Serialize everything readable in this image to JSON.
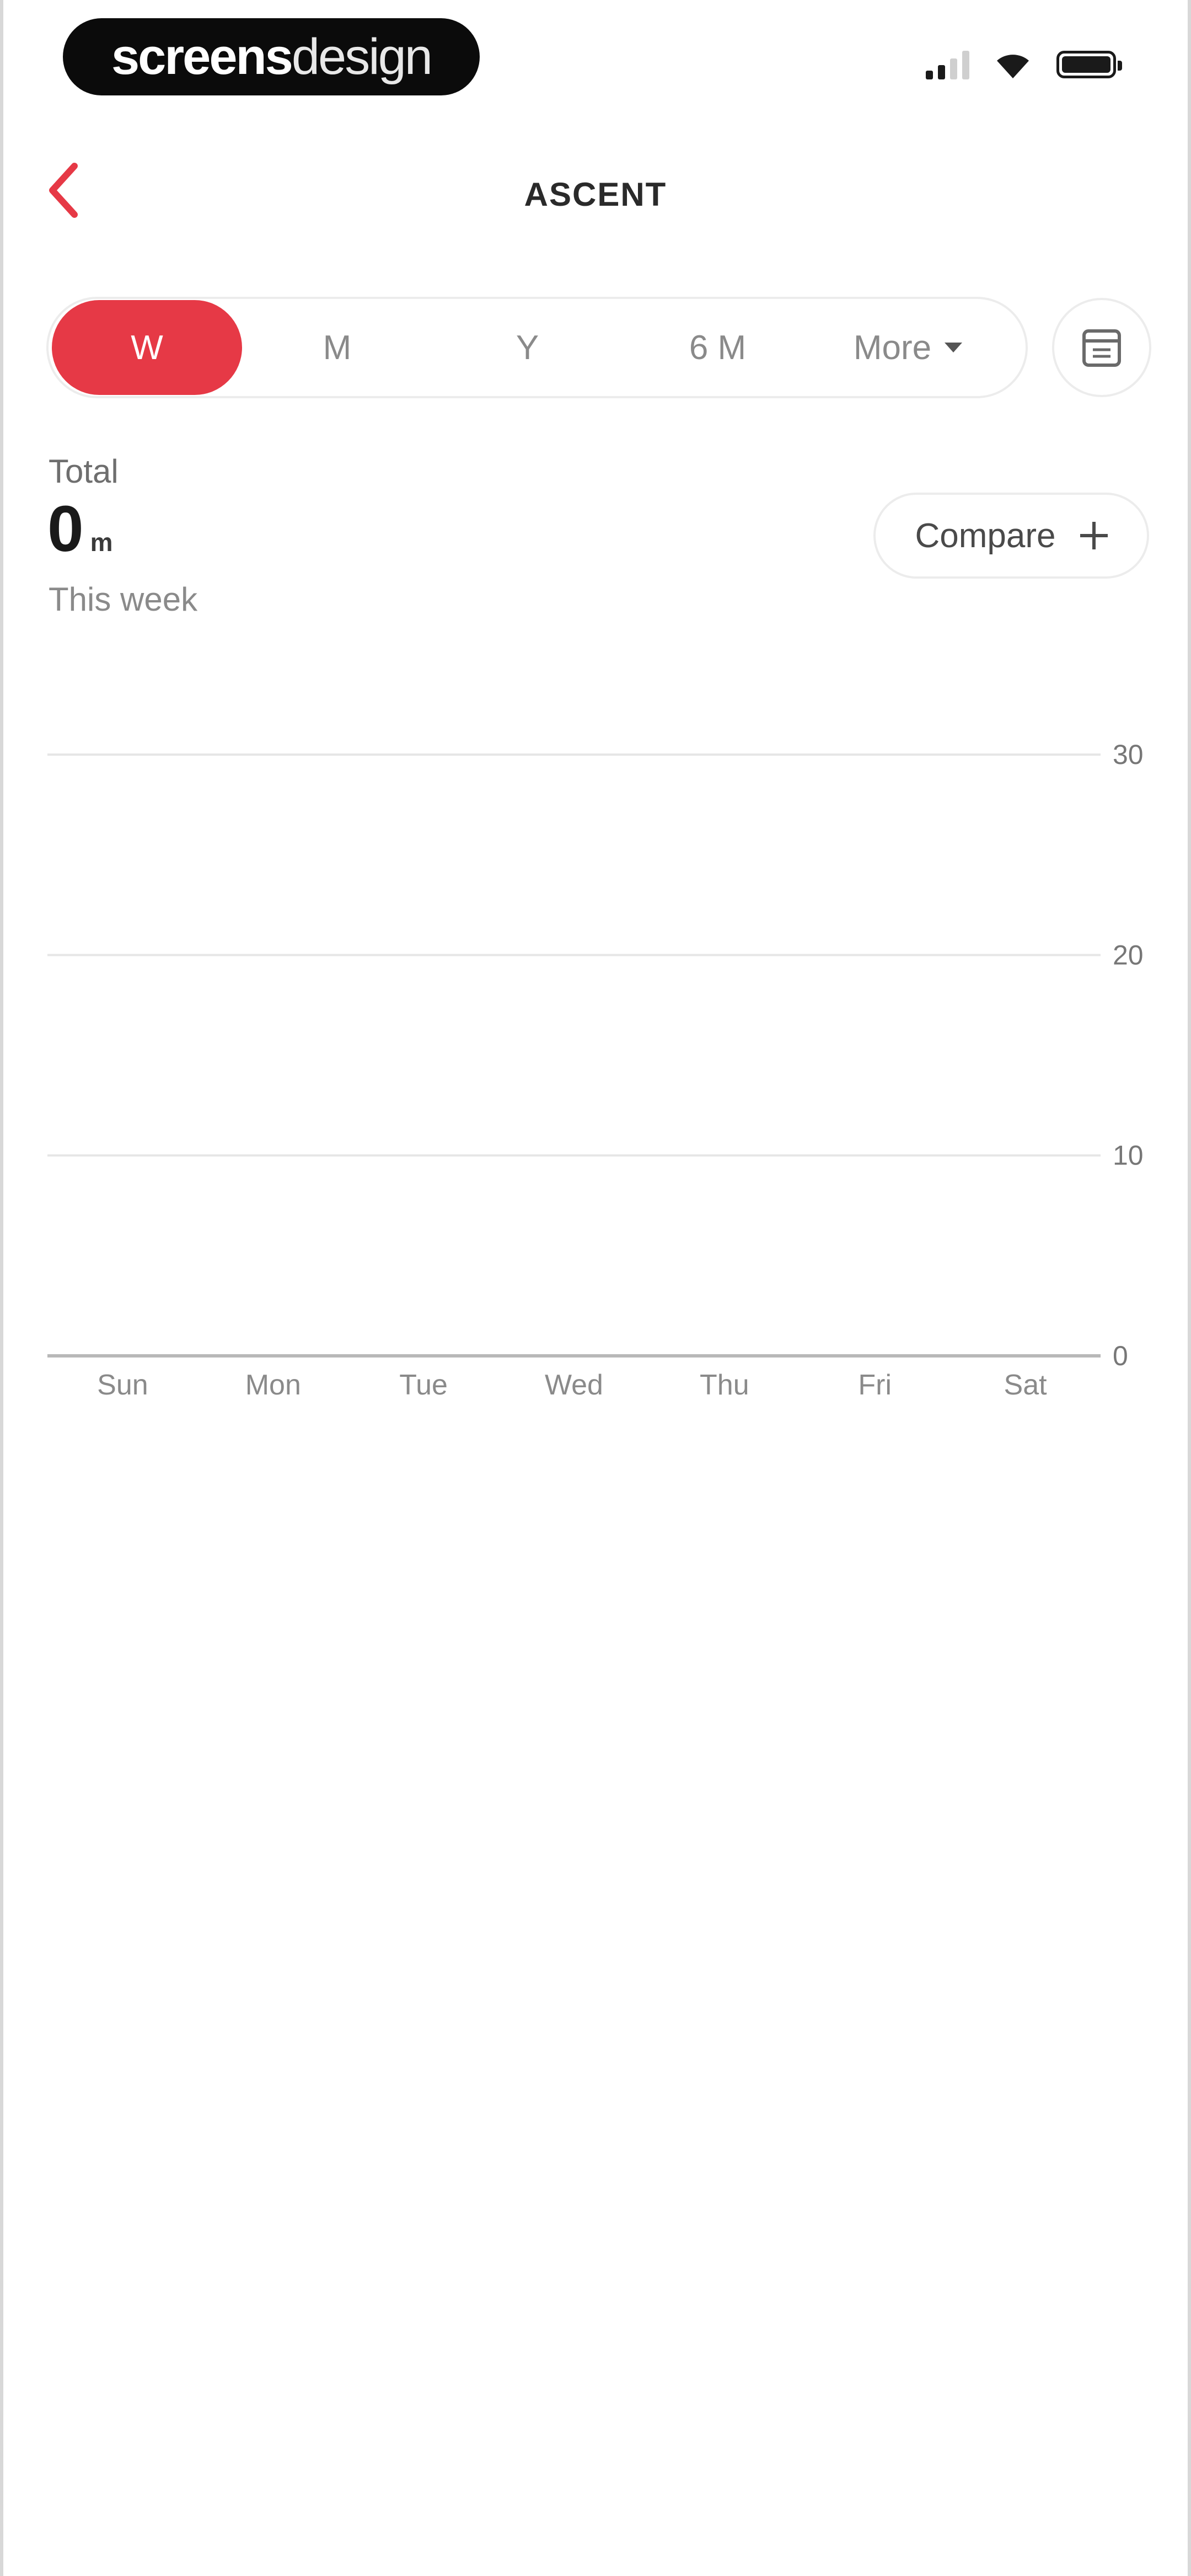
{
  "status_bar": {
    "logo_bold": "screens",
    "logo_thin": "design",
    "icons": [
      "cellular-signal-icon",
      "wifi-icon",
      "battery-icon"
    ]
  },
  "header": {
    "back_icon": "chevron-left-icon",
    "title": "ASCENT"
  },
  "range_tabs": {
    "items": [
      {
        "label": "W",
        "active": true
      },
      {
        "label": "M",
        "active": false
      },
      {
        "label": "Y",
        "active": false
      },
      {
        "label": "6 M",
        "active": false
      },
      {
        "label": "More",
        "active": false
      }
    ],
    "calendar_icon": "calendar-icon"
  },
  "summary": {
    "label": "Total",
    "value": "0",
    "unit": "m",
    "period": "This week",
    "compare_label": "Compare"
  },
  "colors": {
    "accent": "#e63946",
    "gridline": "#e6e6e6",
    "baseline": "#b8b8b8"
  },
  "chart_data": {
    "type": "bar",
    "categories": [
      "Sun",
      "Mon",
      "Tue",
      "Wed",
      "Thu",
      "Fri",
      "Sat"
    ],
    "values": [
      0,
      0,
      0,
      0,
      0,
      0,
      0
    ],
    "yticks": [
      0,
      10,
      20,
      30
    ],
    "ylim": [
      0,
      30
    ],
    "y_axis_side": "right",
    "grid": true
  }
}
